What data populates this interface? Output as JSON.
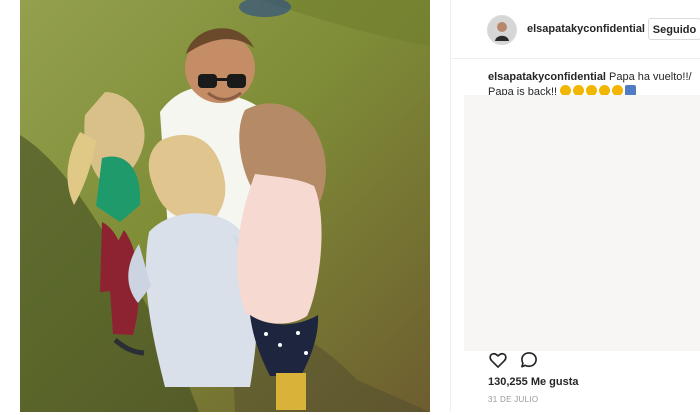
{
  "post": {
    "username": "elsapatakyconfidential",
    "follow_label": "Seguido",
    "caption_user": "elsapatakyconfidential",
    "caption_text": "Papa ha vuelto!!/ Papa is back!!",
    "likes_text": "130,255 Me gusta",
    "date": "31 DE JULIO"
  },
  "icons": {
    "like": "heart-icon",
    "comment": "comment-icon"
  }
}
